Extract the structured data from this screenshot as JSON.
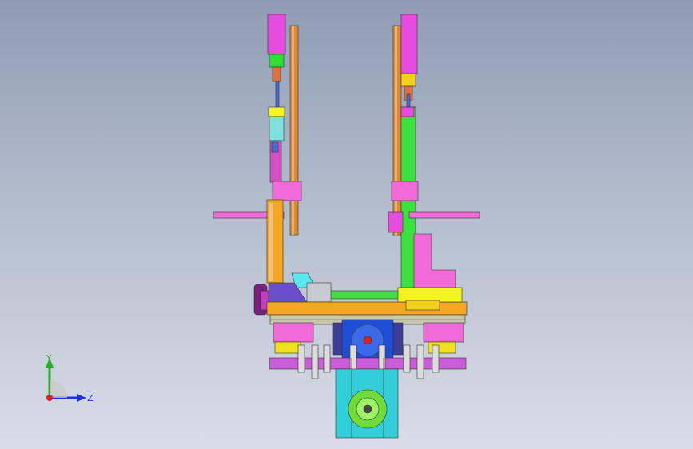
{
  "axes": {
    "y_label": "Y",
    "z_label": "Z",
    "x_color": "#e02020",
    "y_color": "#22b022",
    "z_color": "#2030e0"
  },
  "palette": {
    "background_top": "#8f9cb3",
    "background_bottom": "#d9dde6",
    "magenta": "#f06ad8",
    "orange": "#f5a623",
    "copper": "#d98a3a",
    "green": "#2ee02e",
    "lime": "#6fdc3a",
    "blue": "#1f4fd8",
    "cyan": "#33cfd9",
    "yellow": "#f3f320",
    "purple": "#b03ac9",
    "gray": "#b8b8b8"
  }
}
